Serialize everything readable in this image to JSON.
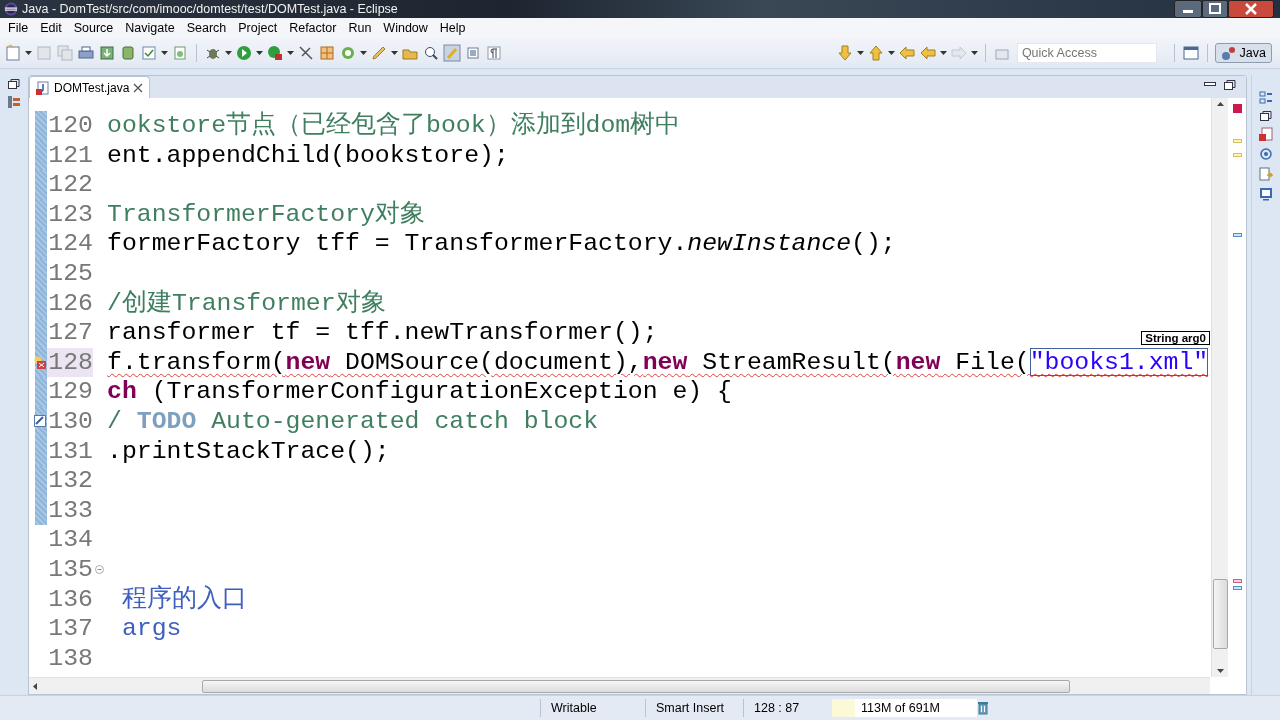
{
  "window": {
    "title": "Java - DomTest/src/com/imooc/domtest/test/DOMTest.java - Eclipse"
  },
  "menu": [
    {
      "label": "File"
    },
    {
      "label": "Edit"
    },
    {
      "label": "Source"
    },
    {
      "label": "Navigate"
    },
    {
      "label": "Search"
    },
    {
      "label": "Project"
    },
    {
      "label": "Refactor"
    },
    {
      "label": "Run"
    },
    {
      "label": "Window"
    },
    {
      "label": "Help"
    }
  ],
  "quick_access": {
    "placeholder": "Quick Access"
  },
  "perspective": {
    "label": "Java",
    "selected": true
  },
  "editor_tab": {
    "label": "DOMTest.java",
    "selected": true
  },
  "code_lines": [
    {
      "number": "120",
      "changed": true,
      "current": false,
      "error": false,
      "task": false,
      "fold": false,
      "tokens": [
        {
          "kind": "comment",
          "text": "ookstore节点（已经包含了book）添加到dom树中"
        }
      ]
    },
    {
      "number": "121",
      "changed": true,
      "current": false,
      "error": false,
      "task": false,
      "fold": false,
      "tokens": [
        {
          "kind": "plain",
          "text": "ent.appendChild(bookstore);"
        }
      ]
    },
    {
      "number": "122",
      "changed": true,
      "current": false,
      "error": false,
      "task": false,
      "fold": false
    },
    {
      "number": "123",
      "changed": true,
      "current": false,
      "error": false,
      "task": false,
      "fold": false,
      "tokens": [
        {
          "kind": "comment",
          "text": "TransformerFactory对象"
        }
      ]
    },
    {
      "number": "124",
      "changed": true,
      "current": false,
      "error": false,
      "task": false,
      "fold": false,
      "tokens": [
        {
          "kind": "plain",
          "text": "formerFactory tff = TransformerFactory."
        },
        {
          "kind": "italic",
          "text": "newInstance"
        },
        {
          "kind": "plain",
          "text": "();"
        }
      ]
    },
    {
      "number": "125",
      "changed": true,
      "current": false,
      "error": false,
      "task": false,
      "fold": false
    },
    {
      "number": "126",
      "changed": true,
      "current": false,
      "error": false,
      "task": false,
      "fold": false,
      "tokens": [
        {
          "kind": "comment",
          "text": "/创建Transformer对象"
        }
      ]
    },
    {
      "number": "127",
      "changed": true,
      "current": false,
      "error": false,
      "task": false,
      "fold": false,
      "tokens": [
        {
          "kind": "plain",
          "text": "ransformer tf = tff.newTransformer();"
        }
      ]
    },
    {
      "number": "128",
      "changed": true,
      "current": true,
      "error": true,
      "task": false,
      "fold": false,
      "tokens": [
        {
          "kind": "plain",
          "text": "f.transform("
        },
        {
          "kind": "keyword",
          "text": "new"
        },
        {
          "kind": "plain",
          "text": " DOMSource(document),"
        },
        {
          "kind": "keyword",
          "text": "new"
        },
        {
          "kind": "plain",
          "text": " StreamResult("
        },
        {
          "kind": "keyword",
          "text": "new"
        },
        {
          "kind": "plain",
          "text": " File("
        },
        {
          "kind": "linked_string",
          "text": "\"books1.xml\""
        }
      ]
    },
    {
      "number": "129",
      "changed": true,
      "current": false,
      "error": false,
      "task": false,
      "fold": false,
      "tokens": [
        {
          "kind": "keyword",
          "text": "ch"
        },
        {
          "kind": "plain",
          "text": " (TransformerConfigurationException e) {"
        }
      ]
    },
    {
      "number": "130",
      "changed": true,
      "current": false,
      "error": false,
      "task": true,
      "fold": false,
      "tokens": [
        {
          "kind": "comment",
          "text": "/ "
        },
        {
          "kind": "todo",
          "text": "TODO"
        },
        {
          "kind": "comment",
          "text": " Auto-generated catch block"
        }
      ]
    },
    {
      "number": "131",
      "changed": true,
      "current": false,
      "error": false,
      "task": false,
      "fold": false,
      "tokens": [
        {
          "kind": "plain",
          "text": ".printStackTrace();"
        }
      ]
    },
    {
      "number": "132",
      "changed": true,
      "current": false,
      "error": false,
      "task": false,
      "fold": false
    },
    {
      "number": "133",
      "changed": true,
      "current": false,
      "error": false,
      "task": false,
      "fold": false
    },
    {
      "number": "134",
      "changed": false,
      "current": false,
      "error": false,
      "task": false,
      "fold": false
    },
    {
      "number": "135",
      "changed": false,
      "current": false,
      "error": false,
      "task": false,
      "fold": true
    },
    {
      "number": "136",
      "changed": false,
      "current": false,
      "error": false,
      "task": false,
      "fold": false,
      "tokens": [
        {
          "kind": "javadoc",
          "text": " 程序的入口"
        }
      ]
    },
    {
      "number": "137",
      "changed": false,
      "current": false,
      "error": false,
      "task": false,
      "fold": false,
      "tokens": [
        {
          "kind": "javadoc",
          "text": " args"
        }
      ]
    },
    {
      "number": "138",
      "changed": false,
      "current": false,
      "error": false,
      "task": false,
      "fold": false
    }
  ],
  "tooltip": {
    "text": "String arg0"
  },
  "status_bar": {
    "writable": "Writable",
    "insert_mode": "Smart Insert",
    "position": "128 : 87",
    "heap": {
      "text": "113M of 691M",
      "level": 0.16
    }
  }
}
